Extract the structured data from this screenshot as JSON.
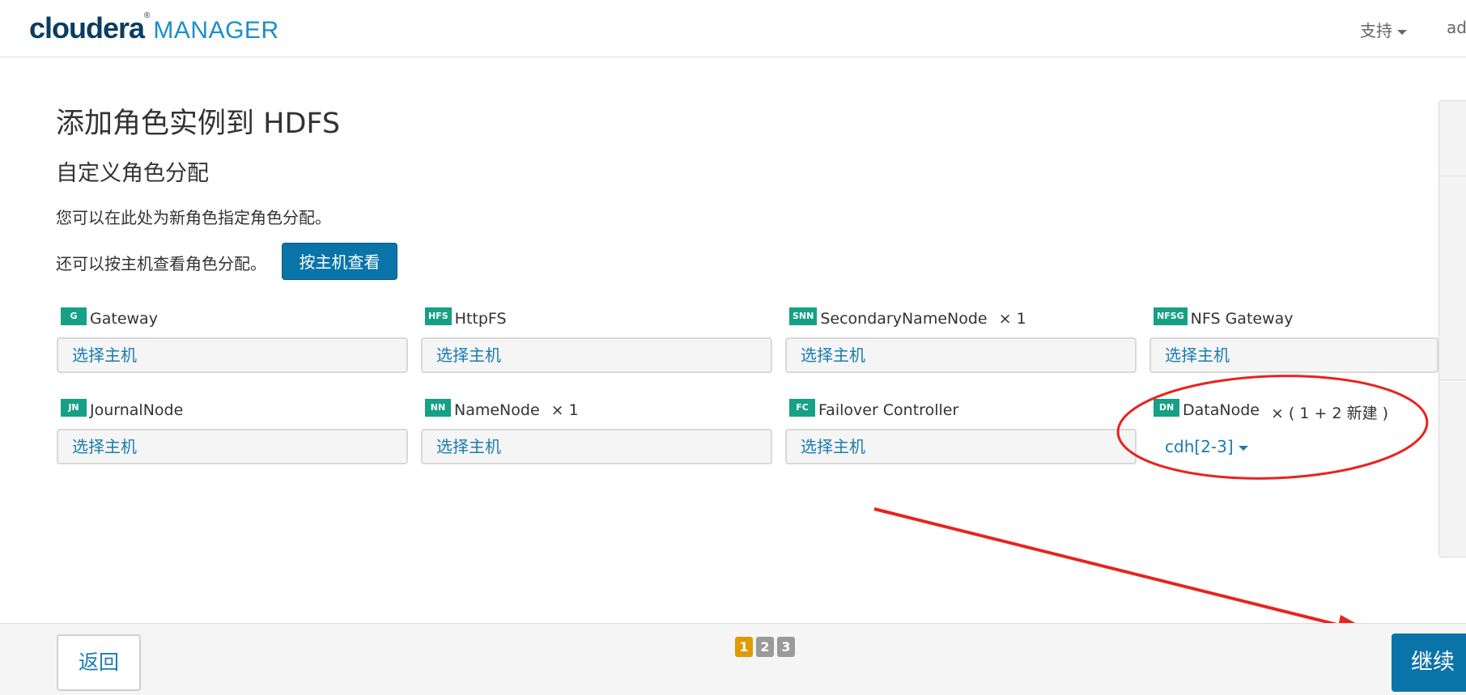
{
  "header": {
    "brand": "cloudera",
    "brand_mark": "®",
    "product": "MANAGER",
    "support_label": "支持",
    "user_label": "ad"
  },
  "page": {
    "title": "添加角色实例到 HDFS",
    "subtitle": "自定义角色分配",
    "description": "您可以在此处为新角色指定角色分配。",
    "view_by_host_text": "还可以按主机查看角色分配。",
    "view_by_host_button": "按主机查看"
  },
  "roles": [
    {
      "abbr": "G",
      "name": "Gateway",
      "count": "",
      "value": "选择主机"
    },
    {
      "abbr": "HFS",
      "name": "HttpFS",
      "count": "",
      "value": "选择主机"
    },
    {
      "abbr": "SNN",
      "name": "SecondaryNameNode",
      "count": "×  1",
      "value": "选择主机"
    },
    {
      "abbr": "NFSG",
      "name": "NFS Gateway",
      "count": "",
      "value": "选择主机"
    },
    {
      "abbr": "JN",
      "name": "JournalNode",
      "count": "",
      "value": "选择主机"
    },
    {
      "abbr": "NN",
      "name": "NameNode",
      "count": "×  1",
      "value": "选择主机"
    },
    {
      "abbr": "FC",
      "name": "Failover Controller",
      "count": "",
      "value": "选择主机"
    },
    {
      "abbr": "DN",
      "name": "DataNode",
      "count": "×  ( 1 + 2 新建 )",
      "value": "cdh[2-3]"
    }
  ],
  "footer": {
    "back_label": "返回",
    "pages": [
      "1",
      "2",
      "3"
    ],
    "current_page": "1",
    "continue_label": "继续"
  },
  "colors": {
    "primary_button": "#0a74a8",
    "link": "#1a7cb0",
    "role_badge": "#16a085",
    "active_page": "#e09b00",
    "annotation": "#e8231d"
  }
}
